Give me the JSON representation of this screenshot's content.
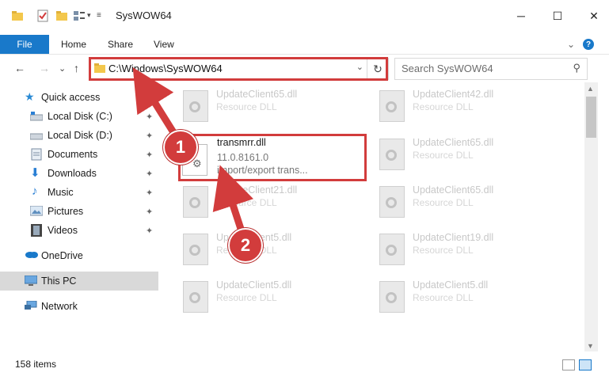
{
  "window": {
    "title": "SysWOW64",
    "minimize_glyph": "─",
    "maximize_glyph": "☐",
    "close_glyph": "✕"
  },
  "ribbon": {
    "tabs": [
      "File",
      "Home",
      "Share",
      "View"
    ],
    "collapse_glyph": "⌄",
    "help_glyph": "?"
  },
  "nav": {
    "back_glyph": "←",
    "forward_glyph": "→",
    "recent_glyph": "⌄",
    "up_glyph": "↑",
    "address": "C:\\Windows\\SysWOW64",
    "address_drop_glyph": "⌄",
    "refresh_glyph": "↻",
    "search_placeholder": "Search SysWOW64",
    "search_glyph": "⚲"
  },
  "sidebar": {
    "quick_access": "Quick access",
    "items": [
      {
        "label": "Local Disk (C:)",
        "icon": "drive-icon"
      },
      {
        "label": "Local Disk (D:)",
        "icon": "drive-icon"
      },
      {
        "label": "Documents",
        "icon": "documents-icon"
      },
      {
        "label": "Downloads",
        "icon": "downloads-icon"
      },
      {
        "label": "Music",
        "icon": "music-icon"
      },
      {
        "label": "Pictures",
        "icon": "pictures-icon"
      },
      {
        "label": "Videos",
        "icon": "videos-icon"
      }
    ],
    "onedrive": "OneDrive",
    "this_pc": "This PC",
    "network": "Network",
    "pin_glyph": "📌"
  },
  "files": {
    "left_column": [
      {
        "name": "UpdateClient65.dll",
        "type": "Resource DLL"
      },
      {
        "name": "UpdateClient21.dll",
        "type": "Resource DLL"
      },
      {
        "name": "UpdateClient5.dll",
        "type": "Resource DLL"
      },
      {
        "name": "UpdateClient5.dll",
        "type": "Resource DLL"
      }
    ],
    "right_column": [
      {
        "name": "UpdateClient42.dll",
        "type": "Resource DLL"
      },
      {
        "name": "UpdateClient65.dll",
        "type": "Resource DLL"
      },
      {
        "name": "UpdateClient65.dll",
        "type": "Resource DLL"
      },
      {
        "name": "UpdateClient19.dll",
        "type": "Resource DLL"
      },
      {
        "name": "UpdateClient5.dll",
        "type": "Resource DLL"
      }
    ],
    "highlighted": {
      "name": "transmrr.dll",
      "version": "11.0.8161.0",
      "description": "import/export trans..."
    }
  },
  "status": {
    "count": "158 items"
  },
  "annotations": {
    "step1": "1",
    "step2": "2",
    "color": "#d23c3c"
  }
}
